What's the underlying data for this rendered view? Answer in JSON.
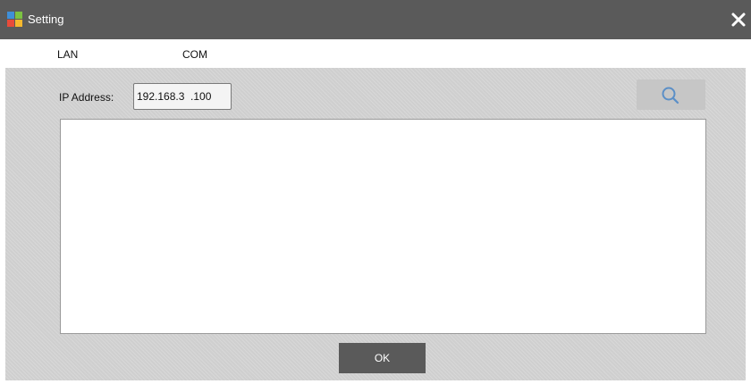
{
  "window": {
    "title": "Setting",
    "icon": "app-icon",
    "close_icon": "close-icon"
  },
  "tabs": [
    {
      "label": "LAN"
    },
    {
      "label": "COM"
    }
  ],
  "lan": {
    "ip_label": "IP Address:",
    "ip_value": "192.168.3  .100",
    "search_icon": "search-icon",
    "device_list_items": []
  },
  "footer": {
    "ok_label": "OK"
  },
  "colors": {
    "titlebar": "#5a5a5a",
    "panel": "#cfcfcf",
    "button_dark": "#5a5a5a",
    "search_icon": "#5b8fc7"
  }
}
